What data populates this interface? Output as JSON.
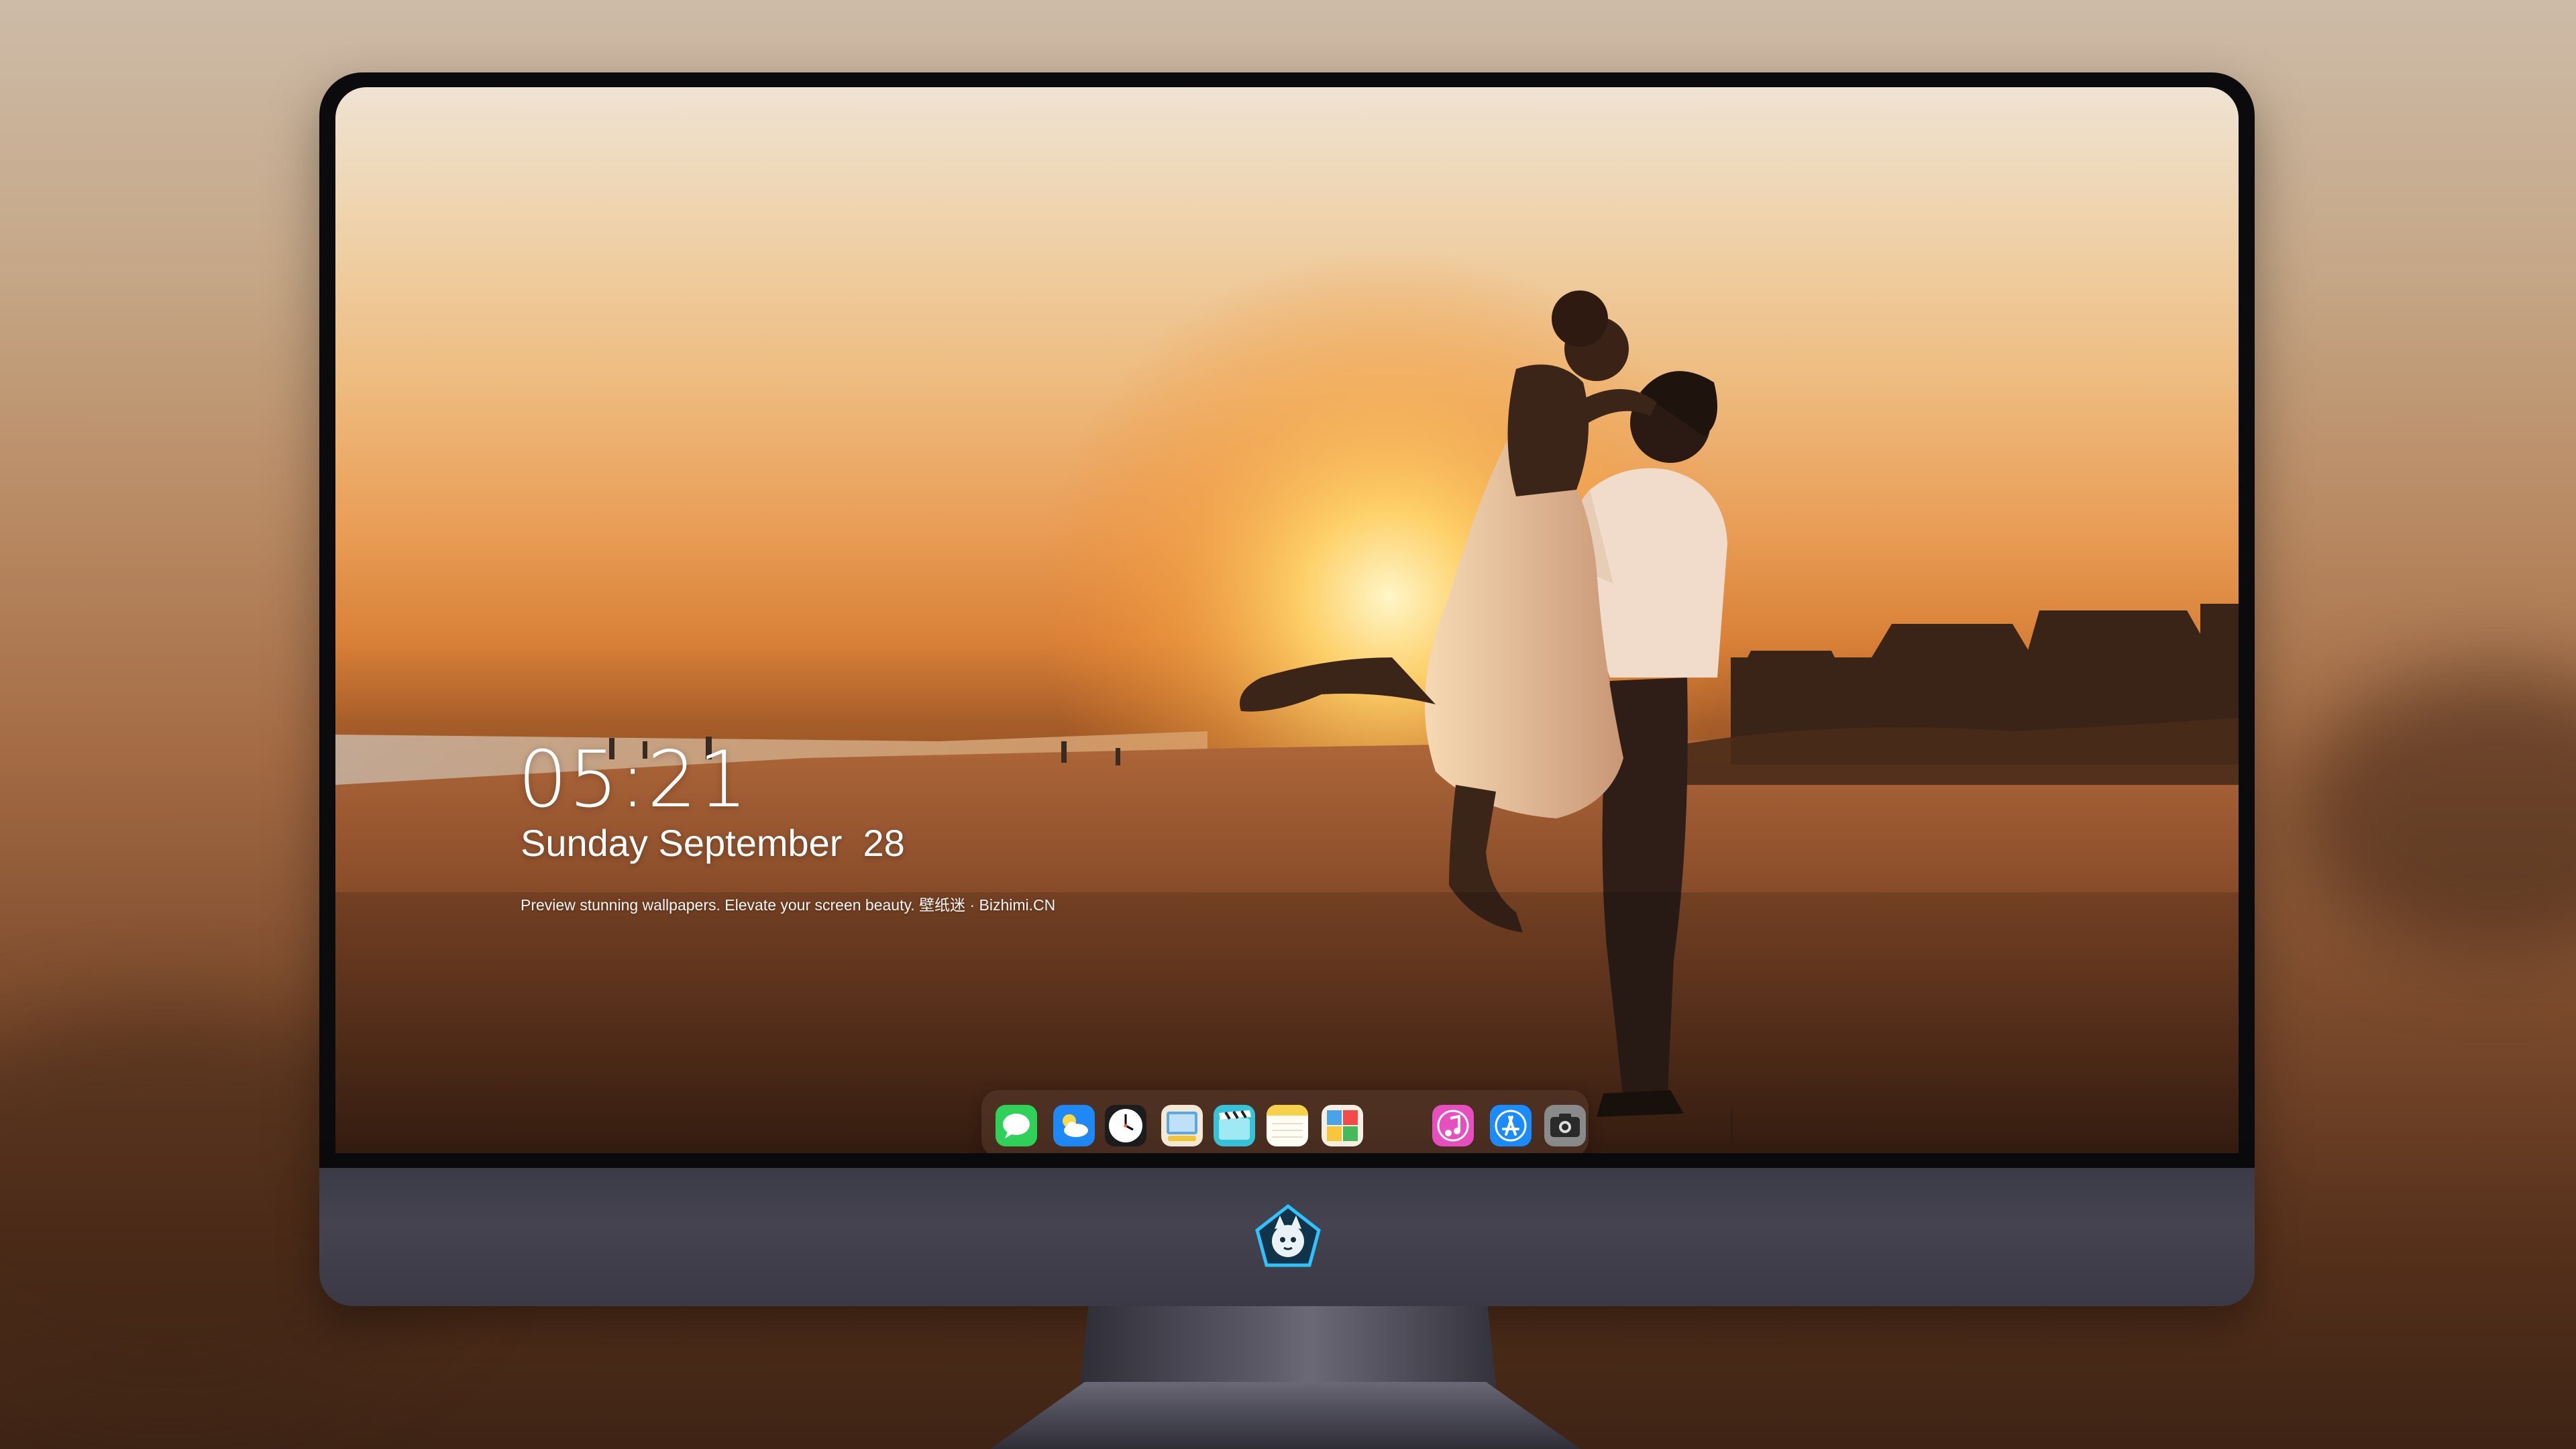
{
  "lockscreen": {
    "time": "05:21",
    "date": "Sunday September  28",
    "tagline": "Preview stunning wallpapers. Elevate your screen beauty. 壁纸迷 · Bizhimi.CN"
  },
  "dock": {
    "apps": [
      {
        "name": "messages-icon",
        "color": "#2fd158"
      },
      {
        "name": "weather-icon",
        "color": "#1e88f5"
      },
      {
        "name": "clock-icon",
        "color": "#1c1c1e"
      },
      {
        "name": "preview-icon",
        "color": "#f2c23a"
      },
      {
        "name": "clips-icon",
        "color": "#36c2d9"
      },
      {
        "name": "notes-icon",
        "color": "#f7d14a"
      },
      {
        "name": "photo-booth-icon",
        "color": "#4aa3e6"
      },
      {
        "name": "itunes-icon",
        "color": "#e74fbf"
      },
      {
        "name": "app-store-icon",
        "color": "#1a8cff"
      },
      {
        "name": "screenshot-icon",
        "color": "#6b6b6b"
      }
    ]
  },
  "brand": {
    "logo": "bizhimi-logo",
    "accent": "#2ec3ff"
  }
}
